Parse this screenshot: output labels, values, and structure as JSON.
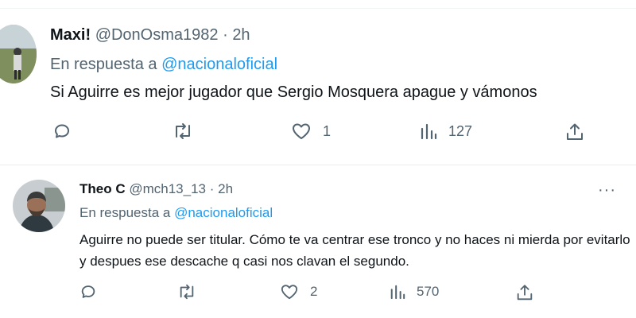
{
  "tweets": [
    {
      "name": "Maxi!",
      "handle": "@DonOsma1982",
      "sep": "·",
      "time": "2h",
      "reply_prefix": "En respuesta a",
      "reply_to": "@nacionaloficial",
      "text": "Si Aguirre es mejor jugador que Sergio Mosquera apague y vámonos",
      "likes": "1",
      "views": "127"
    },
    {
      "name": "Theo C",
      "handle": "@mch13_13",
      "sep": "·",
      "time": "2h",
      "reply_prefix": "En respuesta a",
      "reply_to": "@nacionaloficial",
      "text": "Aguirre no puede ser titular. Cómo te va centrar ese tronco y no haces ni mierda por evitarlo y despues ese descache q casi nos clavan el segundo.",
      "likes": "2",
      "views": "570",
      "more": "···"
    }
  ],
  "colors": {
    "link": "#1d9bf0",
    "muted": "#536471",
    "text": "#0f1419"
  },
  "icons": [
    "reply-icon",
    "retweet-icon",
    "like-icon",
    "views-icon",
    "share-icon",
    "more-icon"
  ]
}
